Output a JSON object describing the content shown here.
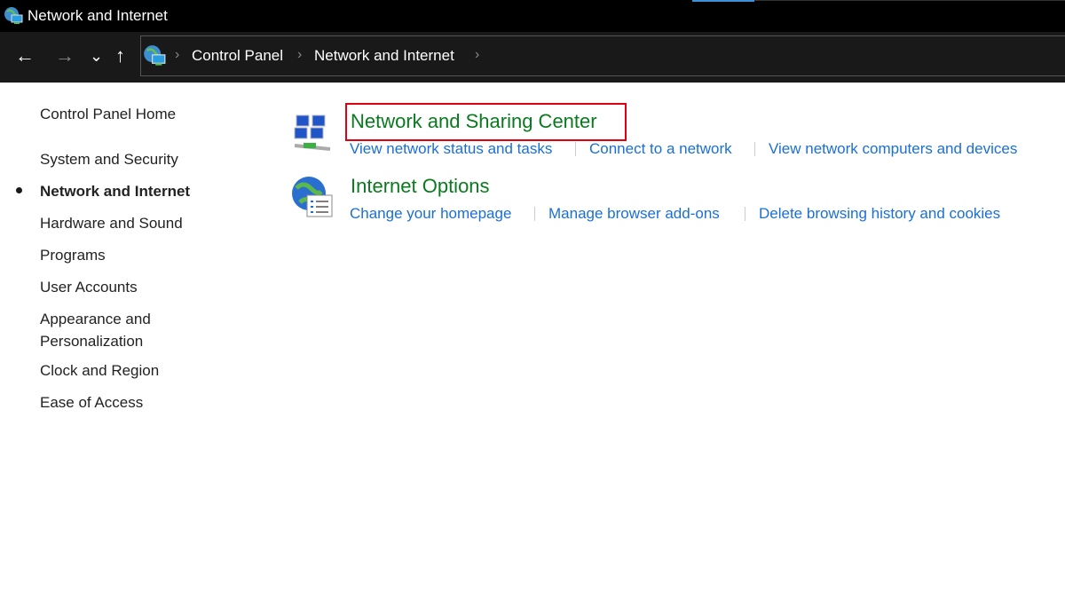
{
  "window": {
    "title": "Network and Internet"
  },
  "nav": {
    "back": "←",
    "forward": "→",
    "recent": "⌄",
    "up": "↑"
  },
  "breadcrumb": [
    "Control Panel",
    "Network and Internet"
  ],
  "sidebar": {
    "home": "Control Panel Home",
    "items": [
      "System and Security",
      "Network and Internet",
      "Hardware and Sound",
      "Programs",
      "User Accounts",
      "Appearance and Personalization",
      "Clock and Region",
      "Ease of Access"
    ],
    "active": "Network and Internet"
  },
  "sections": [
    {
      "title": "Network and Sharing Center",
      "links": [
        "View network status and tasks",
        "Connect to a network",
        "View network computers and devices"
      ]
    },
    {
      "title": "Internet Options",
      "links": [
        "Change your homepage",
        "Manage browser add-ons",
        "Delete browsing history and cookies"
      ]
    }
  ],
  "colors": {
    "heading": "#0a7a1f",
    "link": "#1a6fd6",
    "highlight": "#e00010"
  }
}
